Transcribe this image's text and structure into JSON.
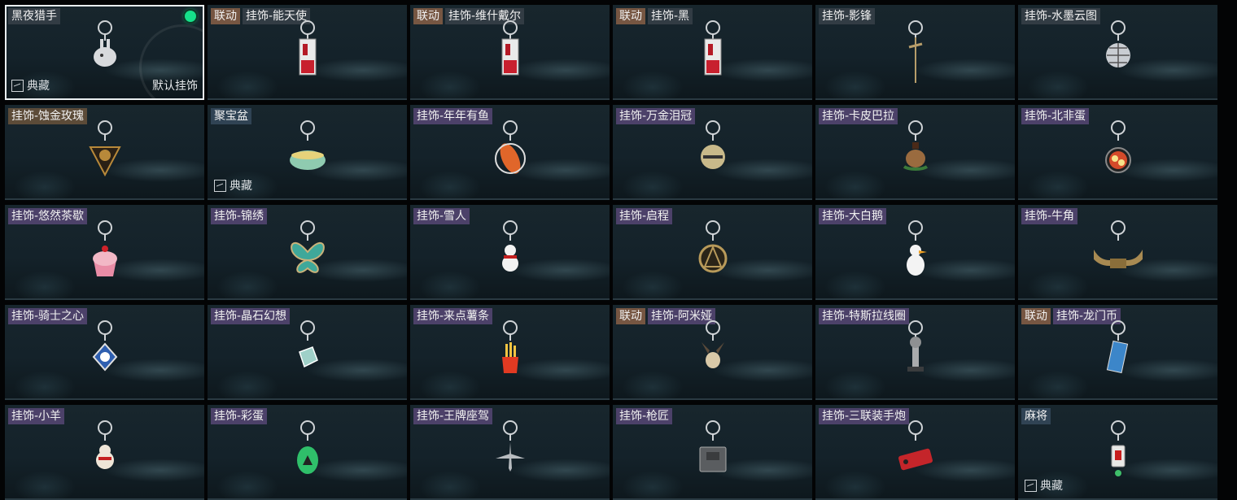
{
  "items": [
    {
      "name": "黑夜猎手",
      "collab": "",
      "collection": "典藏",
      "default": "默认挂饰",
      "equipped": true,
      "selected": true,
      "tier": "gray",
      "icon": "mecha-rabbit-icon",
      "color": "#d8dadd"
    },
    {
      "name": "挂饰-能天使",
      "collab": "联动",
      "collection": "",
      "default": "",
      "equipped": false,
      "selected": false,
      "tier": "gray",
      "icon": "arknights-card-icon",
      "color": "#c8202e"
    },
    {
      "name": "挂饰-维什戴尔",
      "collab": "联动",
      "collection": "",
      "default": "",
      "equipped": false,
      "selected": false,
      "tier": "gray",
      "icon": "arknights-card-icon",
      "color": "#c8202e"
    },
    {
      "name": "挂饰-黑",
      "collab": "联动",
      "collection": "",
      "default": "",
      "equipped": false,
      "selected": false,
      "tier": "gray",
      "icon": "arknights-card-icon",
      "color": "#c8202e"
    },
    {
      "name": "挂饰-影锋",
      "collab": "",
      "collection": "",
      "default": "",
      "equipped": false,
      "selected": false,
      "tier": "gray",
      "icon": "sword-icon",
      "color": "#b79d6a"
    },
    {
      "name": "挂饰-水墨云图",
      "collab": "",
      "collection": "",
      "default": "",
      "equipped": false,
      "selected": false,
      "tier": "gray",
      "icon": "disco-ball-icon",
      "color": "#c9cdd2"
    },
    {
      "name": "挂饰-蚀金玫瑰",
      "collab": "",
      "collection": "",
      "default": "",
      "equipped": false,
      "selected": false,
      "tier": "gold",
      "icon": "rose-emblem-icon",
      "color": "#b8893a"
    },
    {
      "name": "聚宝盆",
      "collab": "",
      "collection": "典藏",
      "default": "",
      "equipped": false,
      "selected": false,
      "tier": "blue",
      "icon": "treasure-bowl-icon",
      "color": "#8fcbb0"
    },
    {
      "name": "挂饰-年年有鱼",
      "collab": "",
      "collection": "",
      "default": "",
      "equipped": false,
      "selected": false,
      "tier": "purple",
      "icon": "fish-icon",
      "color": "#e0662a"
    },
    {
      "name": "挂饰-万金泪冠",
      "collab": "",
      "collection": "",
      "default": "",
      "equipped": false,
      "selected": false,
      "tier": "purple",
      "icon": "crown-icon",
      "color": "#c8b98a"
    },
    {
      "name": "挂饰-卡皮巴拉",
      "collab": "",
      "collection": "",
      "default": "",
      "equipped": false,
      "selected": false,
      "tier": "purple",
      "icon": "capybara-icon",
      "color": "#9a6b3f"
    },
    {
      "name": "挂饰-北非蛋",
      "collab": "",
      "collection": "",
      "default": "",
      "equipped": false,
      "selected": false,
      "tier": "purple",
      "icon": "pan-icon",
      "color": "#d44a2a"
    },
    {
      "name": "挂饰-悠然茶歇",
      "collab": "",
      "collection": "",
      "default": "",
      "equipped": false,
      "selected": false,
      "tier": "purple",
      "icon": "cupcake-icon",
      "color": "#f2b8c6"
    },
    {
      "name": "挂饰-锦绣",
      "collab": "",
      "collection": "",
      "default": "",
      "equipped": false,
      "selected": false,
      "tier": "purple",
      "icon": "butterfly-icon",
      "color": "#3fa89a"
    },
    {
      "name": "挂饰-雪人",
      "collab": "",
      "collection": "",
      "default": "",
      "equipped": false,
      "selected": false,
      "tier": "purple",
      "icon": "snowman-icon",
      "color": "#f2f2f2"
    },
    {
      "name": "挂饰-启程",
      "collab": "",
      "collection": "",
      "default": "",
      "equipped": false,
      "selected": false,
      "tier": "purple",
      "icon": "medallion-icon",
      "color": "#b89a5a"
    },
    {
      "name": "挂饰-大白鹅",
      "collab": "",
      "collection": "",
      "default": "",
      "equipped": false,
      "selected": false,
      "tier": "purple",
      "icon": "goose-icon",
      "color": "#f3f3f3"
    },
    {
      "name": "挂饰-牛角",
      "collab": "",
      "collection": "",
      "default": "",
      "equipped": false,
      "selected": false,
      "tier": "purple",
      "icon": "bull-horns-icon",
      "color": "#a88a52"
    },
    {
      "name": "挂饰-骑士之心",
      "collab": "",
      "collection": "",
      "default": "",
      "equipped": false,
      "selected": false,
      "tier": "purple",
      "icon": "knight-cross-icon",
      "color": "#2f5fb0"
    },
    {
      "name": "挂饰-晶石幻想",
      "collab": "",
      "collection": "",
      "default": "",
      "equipped": false,
      "selected": false,
      "tier": "purple",
      "icon": "crystal-icon",
      "color": "#9fd0c8"
    },
    {
      "name": "挂饰-来点薯条",
      "collab": "",
      "collection": "",
      "default": "",
      "equipped": false,
      "selected": false,
      "tier": "purple",
      "icon": "fries-icon",
      "color": "#e23a22"
    },
    {
      "name": "挂饰-阿米娅",
      "collab": "联动",
      "collection": "",
      "default": "",
      "equipped": false,
      "selected": false,
      "tier": "purple",
      "icon": "amiya-plush-icon",
      "color": "#d9c9a8"
    },
    {
      "name": "挂饰-特斯拉线圈",
      "collab": "",
      "collection": "",
      "default": "",
      "equipped": false,
      "selected": false,
      "tier": "purple",
      "icon": "tesla-coil-icon",
      "color": "#a9abad"
    },
    {
      "name": "挂饰-龙门币",
      "collab": "联动",
      "collection": "",
      "default": "",
      "equipped": false,
      "selected": false,
      "tier": "purple",
      "icon": "lungmen-coin-icon",
      "color": "#3c86c9"
    },
    {
      "name": "挂饰-小羊",
      "collab": "",
      "collection": "",
      "default": "",
      "equipped": false,
      "selected": false,
      "tier": "purple",
      "icon": "sheep-icon",
      "color": "#efe6d8"
    },
    {
      "name": "挂饰-彩蛋",
      "collab": "",
      "collection": "",
      "default": "",
      "equipped": false,
      "selected": false,
      "tier": "purple",
      "icon": "egg-icon",
      "color": "#2fbf6a"
    },
    {
      "name": "挂饰-王牌座驾",
      "collab": "",
      "collection": "",
      "default": "",
      "equipped": false,
      "selected": false,
      "tier": "purple",
      "icon": "jet-icon",
      "color": "#b8bcc0"
    },
    {
      "name": "挂饰-枪匠",
      "collab": "",
      "collection": "",
      "default": "",
      "equipped": false,
      "selected": false,
      "tier": "purple",
      "icon": "toolbox-icon",
      "color": "#5a5d60"
    },
    {
      "name": "挂饰-三联装手炮",
      "collab": "",
      "collection": "",
      "default": "",
      "equipped": false,
      "selected": false,
      "tier": "purple",
      "icon": "rocket-pod-icon",
      "color": "#c4252a"
    },
    {
      "name": "麻将",
      "collab": "",
      "collection": "典藏",
      "default": "",
      "equipped": false,
      "selected": false,
      "tier": "blue",
      "icon": "mahjong-tile-icon",
      "color": "#e8e8e6"
    }
  ]
}
